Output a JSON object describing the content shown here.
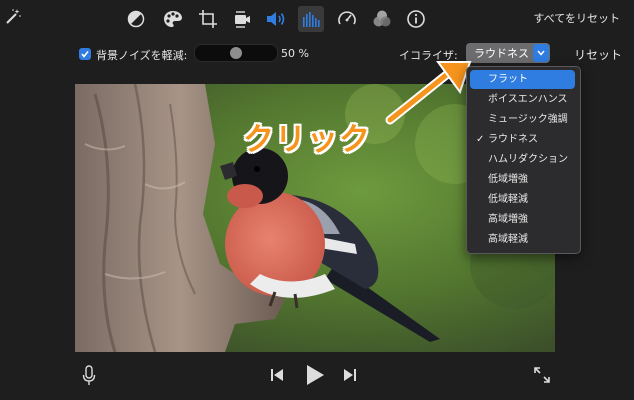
{
  "toolbar": {
    "icons": [
      "magic-wand-icon",
      "color-balance-icon",
      "color-palette-icon",
      "crop-icon",
      "camera-stabilize-icon",
      "volume-icon",
      "equalizer-icon",
      "speed-icon",
      "clip-filter-icon",
      "info-icon"
    ],
    "active": "equalizer-icon",
    "reset_all": "すべてをリセット"
  },
  "audio": {
    "noise_reduction_label": "背景ノイズを軽減:",
    "noise_reduction_checked": true,
    "noise_reduction_value": "50",
    "noise_reduction_unit": "%",
    "equalizer_label": "イコライザ:",
    "equalizer_selected": "ラウドネス",
    "reset_label": "リセット"
  },
  "equalizer_menu": {
    "items": [
      {
        "label": "フラット",
        "highlighted": true,
        "checked": false
      },
      {
        "label": "ボイスエンハンス",
        "highlighted": false,
        "checked": false
      },
      {
        "label": "ミュージック強調",
        "highlighted": false,
        "checked": false
      },
      {
        "label": "ラウドネス",
        "highlighted": false,
        "checked": true
      },
      {
        "label": "ハムリダクション",
        "highlighted": false,
        "checked": false
      },
      {
        "label": "低域増強",
        "highlighted": false,
        "checked": false
      },
      {
        "label": "低域軽減",
        "highlighted": false,
        "checked": false
      },
      {
        "label": "高域増強",
        "highlighted": false,
        "checked": false
      },
      {
        "label": "高域軽減",
        "highlighted": false,
        "checked": false
      }
    ],
    "check_glyph": "✓"
  },
  "annotation": {
    "text": "クリック",
    "color": "#f7941d"
  },
  "playback": {
    "icons": [
      "microphone-icon",
      "previous-icon",
      "play-icon",
      "next-icon",
      "fullscreen-icon"
    ]
  },
  "colors": {
    "accent": "#2f7de0",
    "background": "#1e1e1f"
  }
}
